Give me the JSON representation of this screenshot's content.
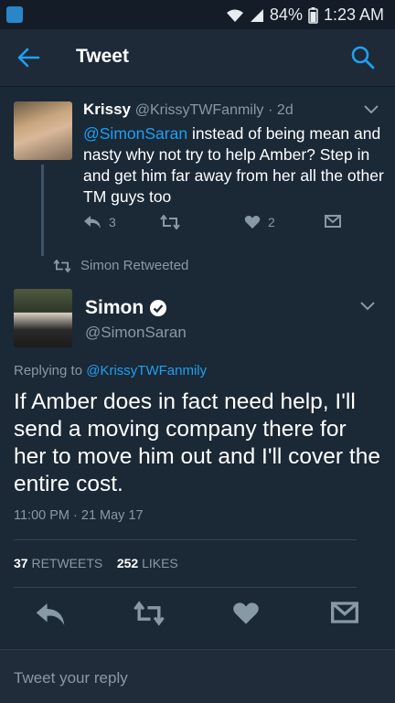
{
  "status_bar": {
    "battery": "84%",
    "time": "1:23 AM"
  },
  "app_bar": {
    "title": "Tweet"
  },
  "reply_tweet": {
    "name": "Krissy",
    "handle": "@KrissyTWFanmily",
    "age": "· 2d",
    "mention": "@SimonSaran",
    "text": " instead of being mean and nasty why not try to help Amber? Step in and get him far away from her all the other TM guys too",
    "reply_count": "3",
    "like_count": "2"
  },
  "retweeted_by": "Simon Retweeted",
  "main_tweet": {
    "name": "Simon",
    "handle": "@SimonSaran",
    "replying_prefix": "Replying to ",
    "replying_to": "@KrissyTWFanmily",
    "text": "If Amber does in fact need help, I'll send a moving company there for her to move him out and I'll cover the entire cost.",
    "timestamp": "11:00 PM · 21 May 17",
    "retweets_count": "37",
    "retweets_label": "RETWEETS",
    "likes_count": "252",
    "likes_label": "LIKES"
  },
  "reply_box": {
    "placeholder": "Tweet your reply"
  },
  "icons": [
    "back-arrow-icon",
    "search-icon",
    "reply-icon",
    "retweet-icon",
    "heart-icon",
    "direct-message-icon",
    "chevron-down-icon",
    "verified-badge-icon",
    "wifi-icon",
    "signal-icon",
    "battery-icon"
  ],
  "colors": {
    "background": "#1b2836",
    "accent": "#1da1f2",
    "muted": "#8899a6"
  }
}
